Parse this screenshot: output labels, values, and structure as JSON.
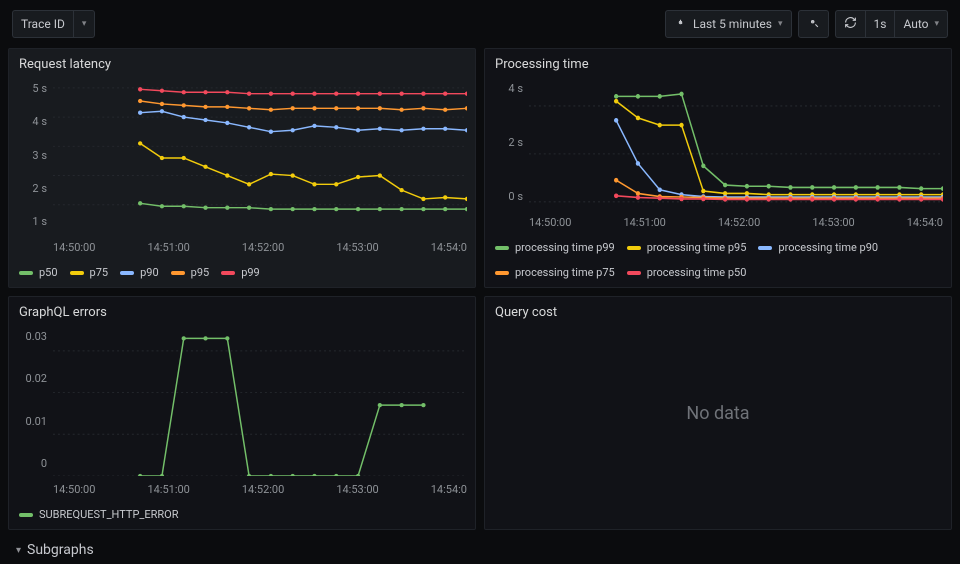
{
  "toolbar": {
    "trace_id_label": "Trace ID",
    "time_range": "Last 5 minutes",
    "refresh_interval": "1s",
    "auto_label": "Auto"
  },
  "panels": {
    "latency": {
      "title": "Request latency"
    },
    "processing": {
      "title": "Processing time"
    },
    "errors": {
      "title": "GraphQL errors"
    },
    "cost": {
      "title": "Query cost",
      "nodata": "No data"
    }
  },
  "section": {
    "subgraphs": "Subgraphs"
  },
  "colors": {
    "green": "#73bf69",
    "yellow": "#f2cc0c",
    "blue": "#8ab8ff",
    "orange": "#ff9830",
    "red": "#f2495c"
  },
  "x_ticks": [
    "14:50:00",
    "14:51:00",
    "14:52:00",
    "14:53:00",
    "14:54:0"
  ],
  "chart_data": [
    {
      "type": "line",
      "title": "Request latency",
      "ylabel": "",
      "xlabel": "",
      "ylim": [
        0,
        5.2
      ],
      "y_ticks": [
        "5 s",
        "4 s",
        "3 s",
        "2 s",
        "1 s"
      ],
      "x": [
        0,
        1,
        2,
        3,
        4,
        5,
        6,
        7,
        8,
        9,
        10,
        11,
        12,
        13,
        14,
        15,
        16,
        17,
        18,
        19
      ],
      "x_offset": 4,
      "series": [
        {
          "name": "p50",
          "color": "green",
          "values": [
            1.05,
            0.95,
            0.95,
            0.9,
            0.9,
            0.9,
            0.85,
            0.85,
            0.85,
            0.85,
            0.85,
            0.85,
            0.85,
            0.85,
            0.85,
            0.85
          ]
        },
        {
          "name": "p75",
          "color": "yellow",
          "values": [
            3.1,
            2.6,
            2.6,
            2.3,
            2.0,
            1.7,
            2.05,
            2.0,
            1.7,
            1.7,
            1.95,
            2.0,
            1.5,
            1.2,
            1.25,
            1.2
          ]
        },
        {
          "name": "p90",
          "color": "blue",
          "values": [
            4.15,
            4.2,
            4.0,
            3.9,
            3.8,
            3.65,
            3.5,
            3.55,
            3.7,
            3.65,
            3.55,
            3.6,
            3.55,
            3.6,
            3.6,
            3.55
          ]
        },
        {
          "name": "p95",
          "color": "orange",
          "values": [
            4.55,
            4.45,
            4.4,
            4.35,
            4.35,
            4.3,
            4.25,
            4.3,
            4.3,
            4.3,
            4.3,
            4.3,
            4.25,
            4.3,
            4.25,
            4.3
          ]
        },
        {
          "name": "p99",
          "color": "red",
          "values": [
            4.95,
            4.9,
            4.85,
            4.85,
            4.85,
            4.8,
            4.8,
            4.8,
            4.8,
            4.8,
            4.8,
            4.8,
            4.8,
            4.8,
            4.8,
            4.8
          ]
        }
      ]
    },
    {
      "type": "line",
      "title": "Processing time",
      "ylabel": "",
      "xlabel": "",
      "ylim": [
        -0.3,
        5.0
      ],
      "y_ticks": [
        "4 s",
        "2 s",
        "0 s"
      ],
      "x": [
        0,
        1,
        2,
        3,
        4,
        5,
        6,
        7,
        8,
        9,
        10,
        11,
        12,
        13,
        14,
        15,
        16,
        17,
        18,
        19
      ],
      "x_offset": 4,
      "series": [
        {
          "name": "processing time p99",
          "color": "green",
          "values": [
            4.4,
            4.4,
            4.4,
            4.5,
            1.5,
            0.7,
            0.65,
            0.65,
            0.6,
            0.6,
            0.6,
            0.6,
            0.6,
            0.6,
            0.55,
            0.55
          ]
        },
        {
          "name": "processing time p95",
          "color": "yellow",
          "values": [
            4.2,
            3.5,
            3.2,
            3.2,
            0.45,
            0.35,
            0.35,
            0.3,
            0.3,
            0.3,
            0.3,
            0.3,
            0.3,
            0.3,
            0.3,
            0.3
          ]
        },
        {
          "name": "processing time p90",
          "color": "blue",
          "values": [
            3.4,
            1.6,
            0.5,
            0.3,
            0.22,
            0.2,
            0.2,
            0.2,
            0.2,
            0.2,
            0.2,
            0.2,
            0.2,
            0.2,
            0.2,
            0.2
          ]
        },
        {
          "name": "processing time p75",
          "color": "orange",
          "values": [
            0.9,
            0.35,
            0.22,
            0.2,
            0.18,
            0.15,
            0.15,
            0.15,
            0.15,
            0.15,
            0.15,
            0.15,
            0.15,
            0.15,
            0.15,
            0.15
          ]
        },
        {
          "name": "processing time p50",
          "color": "red",
          "values": [
            0.25,
            0.18,
            0.15,
            0.12,
            0.12,
            0.1,
            0.1,
            0.1,
            0.1,
            0.1,
            0.1,
            0.1,
            0.1,
            0.1,
            0.1,
            0.1
          ]
        }
      ]
    },
    {
      "type": "line",
      "title": "GraphQL errors",
      "ylabel": "",
      "xlabel": "",
      "ylim": [
        0,
        0.035
      ],
      "y_ticks": [
        "0.03",
        "0.02",
        "0.01",
        "0"
      ],
      "x": [
        0,
        1,
        2,
        3,
        4,
        5,
        6,
        7,
        8,
        9,
        10,
        11,
        12,
        13,
        14,
        15,
        16,
        17,
        18,
        19
      ],
      "x_offset": 4,
      "series": [
        {
          "name": "SUBREQUEST_HTTP_ERROR",
          "color": "green",
          "values": [
            0,
            0,
            0.033,
            0.033,
            0.033,
            0,
            0,
            0,
            0,
            0,
            0,
            0.017,
            0.017,
            0.017
          ]
        }
      ]
    }
  ]
}
